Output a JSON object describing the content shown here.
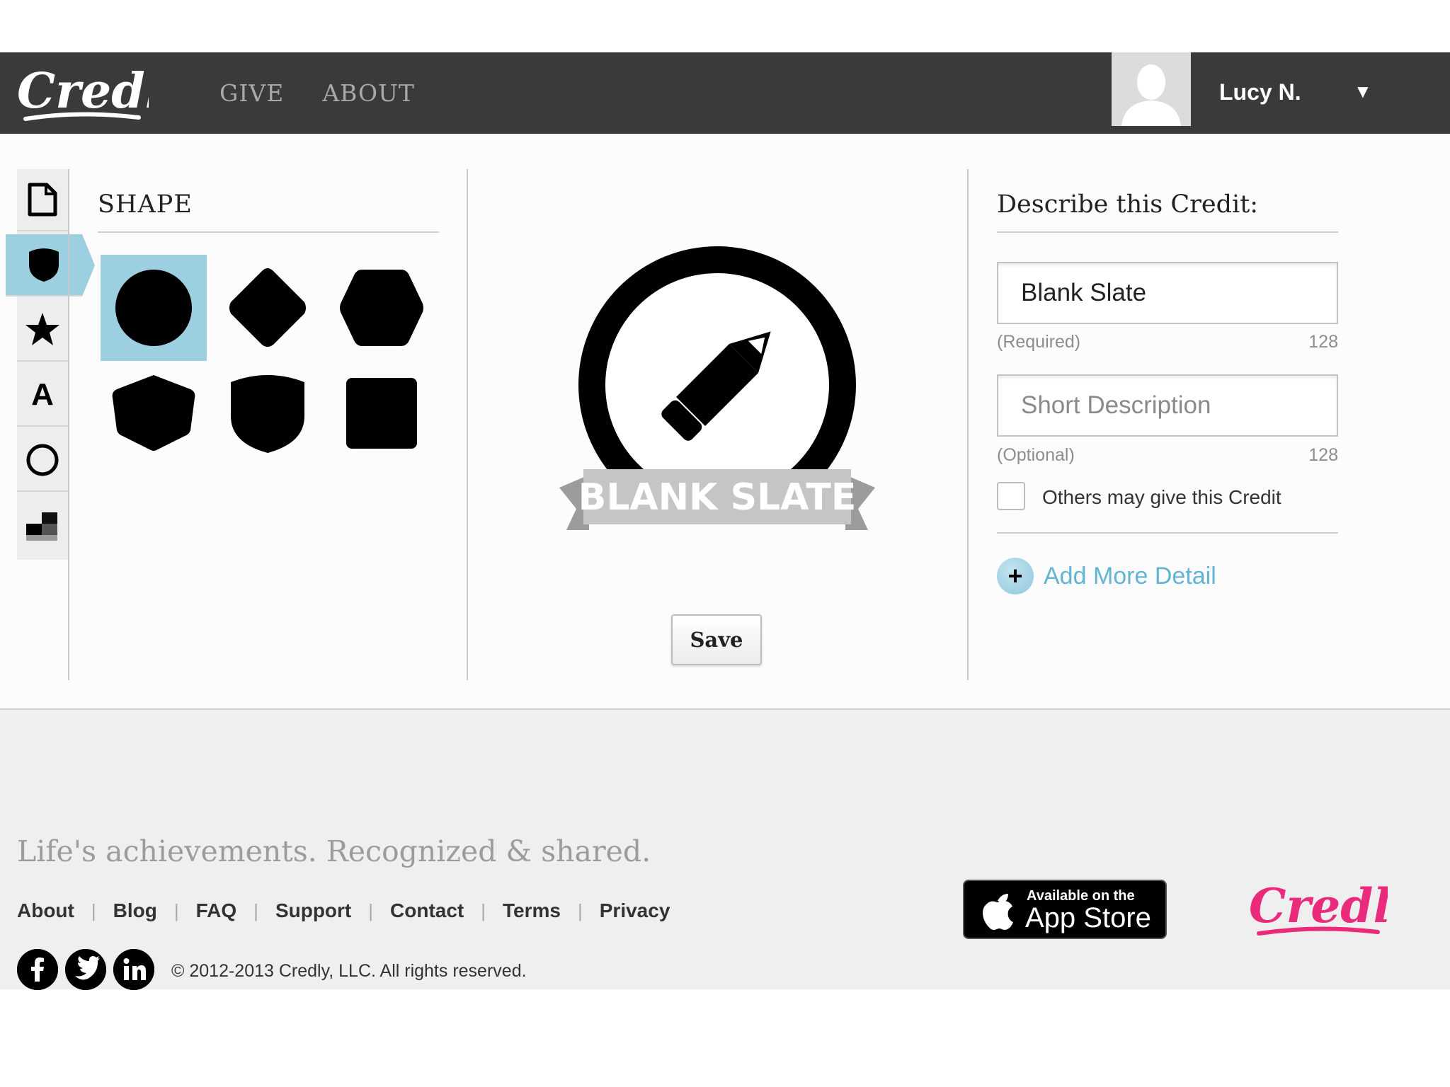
{
  "header": {
    "logo_text": "Credly",
    "nav": [
      {
        "label": "GIVE"
      },
      {
        "label": "ABOUT"
      }
    ],
    "user": {
      "name": "Lucy N."
    }
  },
  "editor": {
    "toolbar": [
      {
        "icon": "page-icon"
      },
      {
        "icon": "shield-icon",
        "active": true
      },
      {
        "icon": "star-icon"
      },
      {
        "icon": "text-icon",
        "label": "A"
      },
      {
        "icon": "circle-icon"
      },
      {
        "icon": "color-swatch-icon"
      }
    ],
    "shape_panel": {
      "title": "SHAPE",
      "shapes": [
        "circle",
        "diamond",
        "hexagon",
        "pentagon",
        "shield",
        "square"
      ],
      "selected": "circle"
    },
    "badge": {
      "banner_text": "BLANK SLATE",
      "icon": "pencil-icon"
    },
    "save_label": "Save",
    "describe": {
      "title": "Describe this Credit:",
      "name_value": "Blank Slate",
      "name_hint": "(Required)",
      "name_count": "128",
      "desc_placeholder": "Short Description",
      "desc_hint": "(Optional)",
      "desc_count": "128",
      "checkbox_label": "Others may give this Credit",
      "add_more_label": "Add More Detail"
    }
  },
  "footer": {
    "tagline": "Life's achievements. Recognized & shared.",
    "links": [
      "About",
      "Blog",
      "FAQ",
      "Support",
      "Contact",
      "Terms",
      "Privacy"
    ],
    "copyright": "© 2012-2013 Credly, LLC. All rights reserved.",
    "appstore_small": "Available on the",
    "appstore_big": "App Store",
    "logo_text": "Credly",
    "socials": [
      "facebook-icon",
      "twitter-icon",
      "linkedin-icon"
    ]
  },
  "colors": {
    "header_bg": "#3a3a3c",
    "accent": "#9ccfe0",
    "link_blue": "#62b4d6",
    "brand_pink": "#ea2a7a"
  }
}
